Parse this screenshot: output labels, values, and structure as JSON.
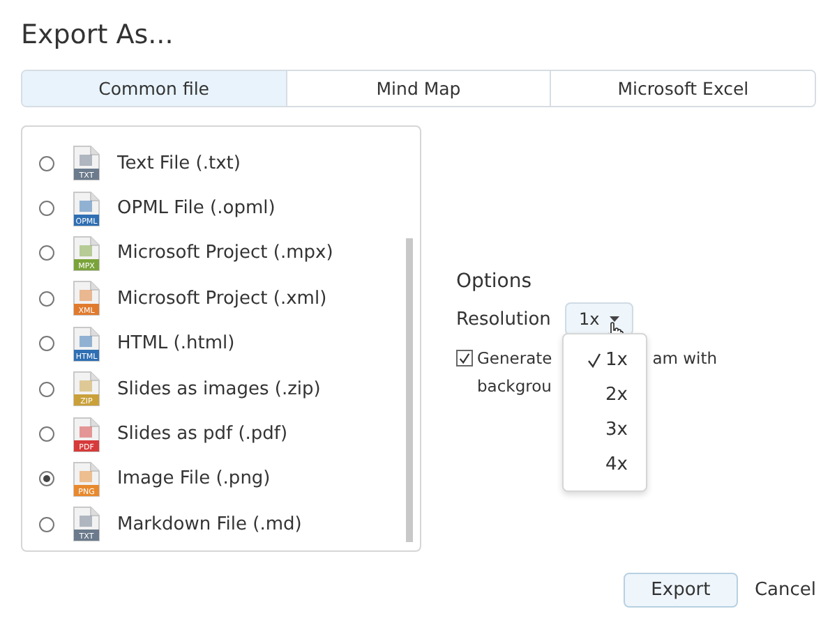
{
  "window": {
    "title": "Export As..."
  },
  "tabs": [
    {
      "label": "Common file",
      "selected": true
    },
    {
      "label": "Mind Map",
      "selected": false
    },
    {
      "label": "Microsoft Excel",
      "selected": false
    }
  ],
  "formats": [
    {
      "label": "Text File (.txt)",
      "badge": "TXT",
      "color": "#6b7a8c",
      "selected": false
    },
    {
      "label": "OPML File (.opml)",
      "badge": "OPML",
      "color": "#2f6fb3",
      "selected": false
    },
    {
      "label": "Microsoft Project (.mpx)",
      "badge": "MPX",
      "color": "#7aa33a",
      "selected": false
    },
    {
      "label": "Microsoft Project (.xml)",
      "badge": "XML",
      "color": "#e07b2e",
      "selected": false
    },
    {
      "label": "HTML (.html)",
      "badge": "HTML",
      "color": "#2f6fb3",
      "selected": false
    },
    {
      "label": "Slides as images (.zip)",
      "badge": "ZIP",
      "color": "#c9a03a",
      "selected": false
    },
    {
      "label": "Slides as pdf (.pdf)",
      "badge": "PDF",
      "color": "#d63a3a",
      "selected": false
    },
    {
      "label": "Image File (.png)",
      "badge": "PNG",
      "color": "#e8892e",
      "selected": true
    },
    {
      "label": "Markdown File (.md)",
      "badge": "TXT",
      "color": "#6b7a8c",
      "selected": false
    }
  ],
  "options": {
    "title": "Options",
    "resolution_label": "Resolution",
    "resolution_value": "1x",
    "resolution_menu": [
      {
        "label": "1x",
        "selected": true
      },
      {
        "label": "2x",
        "selected": false
      },
      {
        "label": "3x",
        "selected": false
      },
      {
        "label": "4x",
        "selected": false
      }
    ],
    "checkbox": {
      "checked": true,
      "visible_text": [
        "Generate",
        "am with",
        "backgrou"
      ]
    }
  },
  "buttons": {
    "export": "Export",
    "cancel": "Cancel"
  }
}
